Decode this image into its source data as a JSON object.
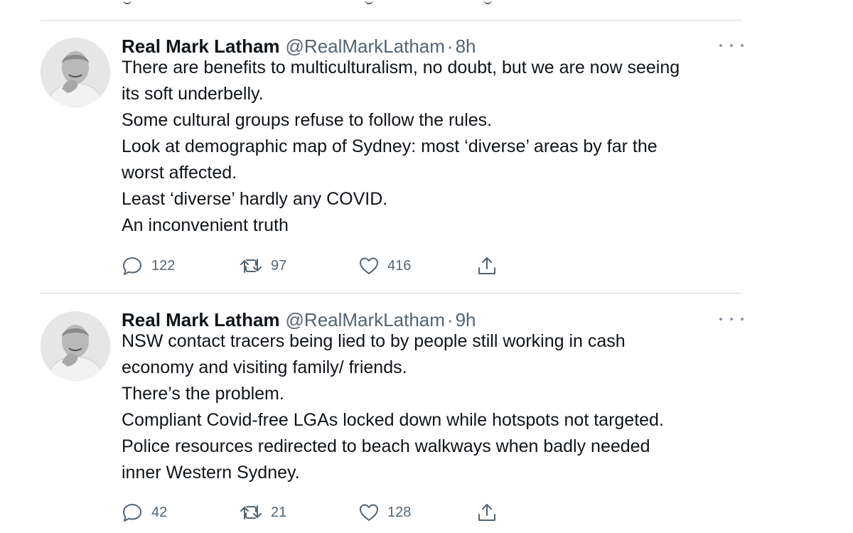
{
  "tweets": [
    {
      "author_name": "Real Mark Latham",
      "handle": "@RealMarkLatham",
      "separator": "·",
      "time": "8h",
      "lines": [
        "There are benefits to multiculturalism, no doubt, but we are now seeing",
        "its soft underbelly.",
        "Some cultural groups refuse to follow the rules.",
        "Look at demographic map of Sydney: most ‘diverse’ areas by far the",
        "worst affected.",
        "Least ‘diverse’ hardly any COVID.",
        "An inconvenient truth"
      ],
      "replies": "122",
      "retweets": "97",
      "likes": "416"
    },
    {
      "author_name": "Real Mark Latham",
      "handle": "@RealMarkLatham",
      "separator": "·",
      "time": "9h",
      "lines": [
        "NSW contact tracers being lied to by people still working in cash",
        "economy and visiting family/ friends.",
        "There’s the problem.",
        "Compliant Covid-free LGAs locked down while hotspots not targeted.",
        "Police resources redirected to beach walkways when badly needed",
        "inner Western Sydney."
      ],
      "replies": "42",
      "retweets": "21",
      "likes": "128"
    }
  ],
  "icons": {
    "reply": "reply-icon",
    "retweet": "retweet-icon",
    "like": "heart-icon",
    "share": "share-icon",
    "more": "more-options-icon"
  },
  "colors": {
    "text": "#0f1419",
    "secondary": "#536471",
    "divider": "#cfd9de"
  }
}
